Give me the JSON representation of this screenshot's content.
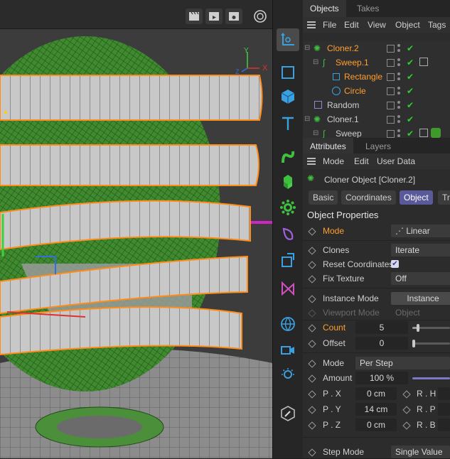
{
  "viewport": {
    "axis_labels": {
      "x": "X",
      "y": "Y",
      "z": "Z"
    }
  },
  "objects_panel": {
    "tabs": [
      "Objects",
      "Takes"
    ],
    "menu": [
      "File",
      "Edit",
      "View",
      "Object",
      "Tags"
    ],
    "rows": [
      {
        "name": "Cloner.2",
        "color": "#ff9f2d",
        "indent": 0,
        "icon": "cloner-icon"
      },
      {
        "name": "Sweep.1",
        "color": "#ff9f2d",
        "indent": 1,
        "icon": "sweep-icon"
      },
      {
        "name": "Rectangle",
        "color": "#ff9f2d",
        "indent": 2,
        "icon": "rectangle-spline-icon"
      },
      {
        "name": "Circle",
        "color": "#ff9f2d",
        "indent": 2,
        "icon": "circle-spline-icon"
      },
      {
        "name": "Random",
        "color": "#cfcfcf",
        "indent": 0,
        "icon": "random-effector-icon"
      },
      {
        "name": "Cloner.1",
        "color": "#cfcfcf",
        "indent": 0,
        "icon": "cloner-icon"
      },
      {
        "name": "Sweep",
        "color": "#cfcfcf",
        "indent": 1,
        "icon": "sweep-icon"
      }
    ]
  },
  "attributes_panel": {
    "tabs": [
      "Attributes",
      "Layers"
    ],
    "menu": [
      "Mode",
      "Edit",
      "User Data"
    ],
    "object_title": "Cloner Object [Cloner.2]",
    "sub_tabs": [
      "Basic",
      "Coordinates",
      "Object",
      "Tr"
    ],
    "section_title": "Object Properties",
    "mode_label": "Mode",
    "mode_value": "Linear",
    "clones_label": "Clones",
    "clones_value": "Iterate",
    "reset_coords_label": "Reset Coordinates",
    "reset_coords_checked": true,
    "fix_texture_label": "Fix Texture",
    "fix_texture_value": "Off",
    "instance_mode_label": "Instance Mode",
    "instance_mode_value": "Instance",
    "viewport_mode_label": "Viewport Mode",
    "viewport_mode_value": "Object",
    "count_label": "Count",
    "count_value": "5",
    "count_slider": 0.15,
    "offset_label": "Offset",
    "offset_value": "0",
    "offset_slider": 0.0,
    "step_mode_label": "Mode",
    "step_mode_value": "Per Step",
    "amount_label": "Amount",
    "amount_value": "100 %",
    "px_label": "P . X",
    "px_value": "0 cm",
    "py_label": "P . Y",
    "py_value": "14 cm",
    "pz_label": "P . Z",
    "pz_value": "0 cm",
    "rh_label": "R . H",
    "rp_label": "R . P",
    "rb_label": "R . B",
    "step_mode2_label": "Step Mode",
    "step_mode2_value": "Single Value"
  },
  "colors": {
    "accent_orange": "#ff9f2d",
    "check_green": "#30d030",
    "selected_tab": "#5a5a9a",
    "ring_gray": "#c8c8c8",
    "mesh_green": "#3f8a2e"
  }
}
